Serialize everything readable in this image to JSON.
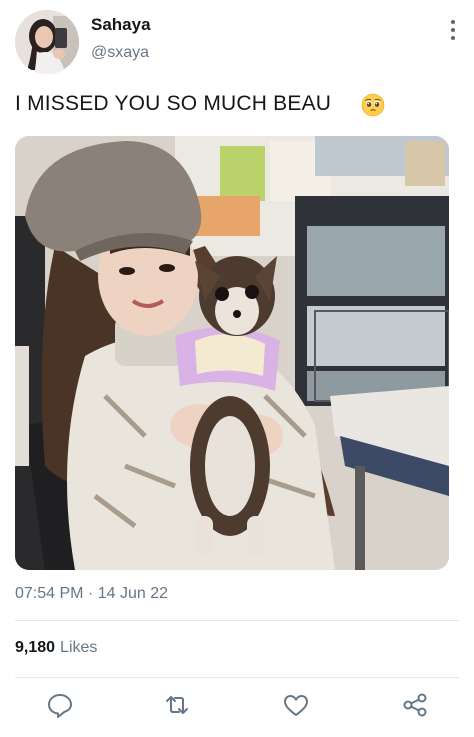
{
  "user": {
    "display_name": "Sahaya",
    "handle": "@sxaya"
  },
  "tweet": {
    "text": "I MISSED YOU SO MUCH BEAU",
    "emoji": "pleading-face-emoji",
    "timestamp": "07:54 PM · 14 Jun 22"
  },
  "stats": {
    "likes_count": "9,180",
    "likes_label": "Likes"
  },
  "icons": {
    "more": "more-options-icon",
    "reply": "reply-icon",
    "retweet": "retweet-icon",
    "like": "heart-icon",
    "share": "share-icon"
  },
  "colors": {
    "text": "#14171a",
    "secondary": "#657786",
    "divider": "#e1e8ed",
    "icon": "#657786"
  }
}
